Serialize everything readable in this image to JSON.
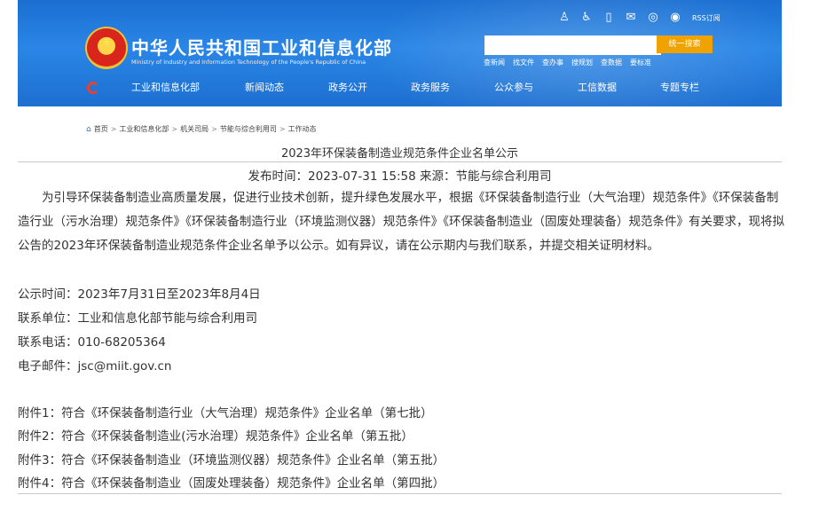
{
  "header": {
    "title": "中华人民共和国工业和信息化部",
    "subtitle": "Ministry of Industry and Information Technology of the People's Republic of China",
    "top_icons": [
      "person-icon",
      "accessibility-icon",
      "mobile-icon",
      "mail-icon",
      "weibo-icon",
      "rss-icon"
    ],
    "rss_label": "RSS订阅",
    "search": {
      "placeholder": "",
      "button_label": "统一搜索"
    },
    "search_links": [
      "查新闻",
      "找文件",
      "查办事",
      "搜规划",
      "查数据",
      "要标准"
    ],
    "nav": [
      "工业和信息化部",
      "新闻动态",
      "政务公开",
      "政务服务",
      "公众参与",
      "工信数据",
      "专题专栏"
    ]
  },
  "breadcrumb": [
    "首页",
    "工业和信息化部",
    "机关司局",
    "节能与综合利用司",
    "工作动态"
  ],
  "article": {
    "title": "2023年环保装备制造业规范条件企业名单公示",
    "meta": "发布时间：2023-07-31 15:58 来源：节能与综合利用司",
    "body": "为引导环保装备制造业高质量发展，促进行业技术创新，提升绿色发展水平，根据《环保装备制造行业（大气治理）规范条件》《环保装备制造行业（污水治理）规范条件》《环保装备制造行业（环境监测仪器）规范条件》《环保装备制造业（固废处理装备）规范条件》有关要求，现将拟公告的2023年环保装备制造业规范条件企业名单予以公示。如有异议，请在公示期内与我们联系，并提交相关证明材料。",
    "period": "公示时间：2023年7月31日至2023年8月4日",
    "unit_label": "联系单位：",
    "unit_value": "工业和信息化部节能与综合利用司",
    "phone": "联系电话：010-68205364",
    "email": "电子邮件：jsc@miit.gov.cn",
    "attachments": [
      "附件1：符合《环保装备制造行业（大气治理）规范条件》企业名单（第七批）",
      "附件2：符合《环保装备制造业(污水治理）规范条件》企业名单（第五批）",
      "附件3：符合《环保装备制造业（环境监测仪器）规范条件》企业名单（第五批）",
      "附件4：符合《环保装备制造业（固废处理装备）规范条件》企业名单（第四批）"
    ]
  },
  "colors": {
    "header_blue": "#2a86e6",
    "search_button": "#f0a300",
    "emblem_red": "#d9261c"
  }
}
